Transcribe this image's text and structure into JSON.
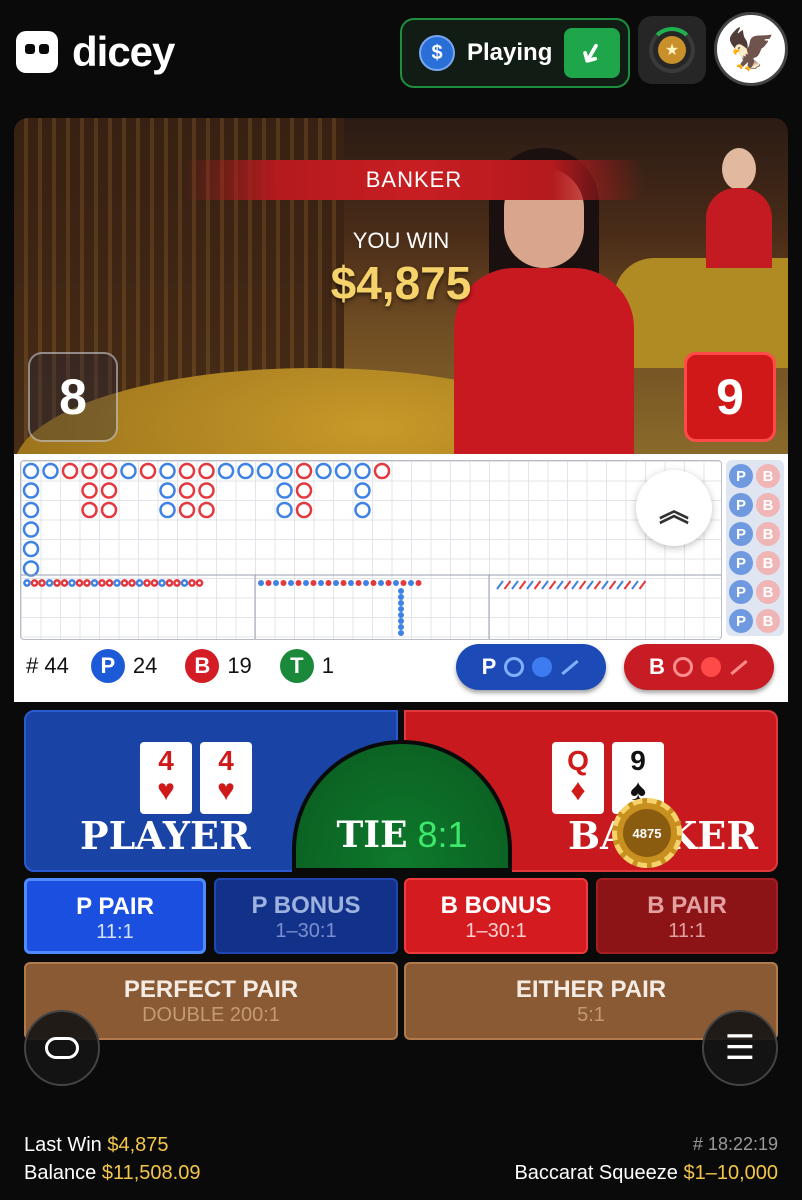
{
  "header": {
    "logo_text": "dicey",
    "playing_label": "Playing",
    "coin_symbol": "$",
    "deposit_arrow": "➜"
  },
  "video": {
    "result_banner": "BANKER",
    "you_win_label": "YOU WIN",
    "win_amount": "$4,875",
    "player_score": "8",
    "banker_score": "9"
  },
  "roadmap": {
    "stats": {
      "hash_label": "# 44",
      "player_letter": "P",
      "player_count": "24",
      "banker_letter": "B",
      "banker_count": "19",
      "tie_letter": "T",
      "tie_count": "1"
    },
    "ask_player_letter": "P",
    "ask_banker_letter": "B",
    "predict_letters": [
      "P",
      "B"
    ],
    "colors": {
      "player": "#1c4bb8",
      "banker": "#c81c24",
      "tie": "#1a8a3a"
    }
  },
  "betting": {
    "player_label": "PLAYER",
    "banker_label": "BANKER",
    "tie_label": "TIE",
    "tie_odds": "8:1",
    "chip_value": "4875",
    "player_cards": [
      {
        "rank": "4",
        "suit": "♥"
      },
      {
        "rank": "4",
        "suit": "♥"
      }
    ],
    "banker_cards": [
      {
        "rank": "Q",
        "suit": "♦"
      },
      {
        "rank": "9",
        "suit": "♠"
      }
    ],
    "side_bets": [
      {
        "title": "P PAIR",
        "odds": "11:1"
      },
      {
        "title": "P BONUS",
        "odds": "1–30:1"
      },
      {
        "title": "B BONUS",
        "odds": "1–30:1"
      },
      {
        "title": "B PAIR",
        "odds": "11:1"
      }
    ],
    "perfect_pair": {
      "title": "PERFECT PAIR",
      "odds": "DOUBLE 200:1"
    },
    "either_pair": {
      "title": "EITHER PAIR",
      "odds": "5:1"
    }
  },
  "footer": {
    "last_win_label": "Last Win",
    "last_win_value": "$4,875",
    "balance_label": "Balance",
    "balance_value": "$11,508.09",
    "round_id": "# 18:22:19",
    "table_name": "Baccarat Squeeze",
    "table_limits": "$1–10,000"
  }
}
